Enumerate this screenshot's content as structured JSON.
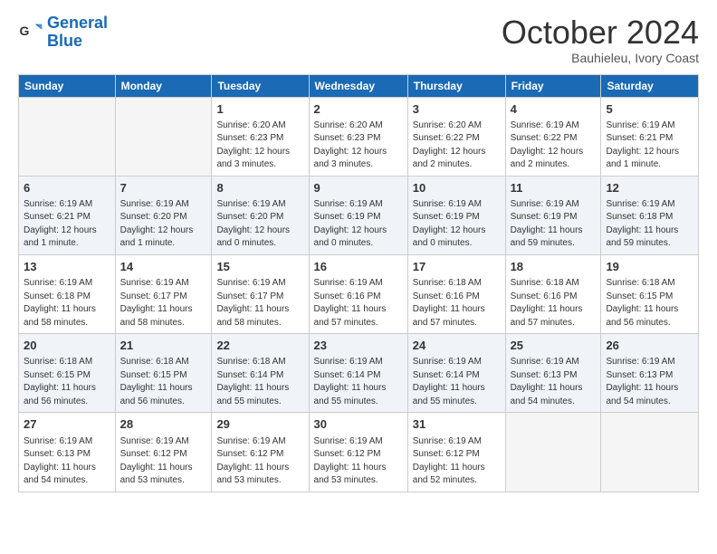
{
  "logo": {
    "line1": "General",
    "line2": "Blue"
  },
  "title": "October 2024",
  "subtitle": "Bauhieleu, Ivory Coast",
  "days_of_week": [
    "Sunday",
    "Monday",
    "Tuesday",
    "Wednesday",
    "Thursday",
    "Friday",
    "Saturday"
  ],
  "weeks": [
    [
      {
        "day": "",
        "info": ""
      },
      {
        "day": "",
        "info": ""
      },
      {
        "day": "1",
        "info": "Sunrise: 6:20 AM\nSunset: 6:23 PM\nDaylight: 12 hours and 3 minutes."
      },
      {
        "day": "2",
        "info": "Sunrise: 6:20 AM\nSunset: 6:23 PM\nDaylight: 12 hours and 3 minutes."
      },
      {
        "day": "3",
        "info": "Sunrise: 6:20 AM\nSunset: 6:22 PM\nDaylight: 12 hours and 2 minutes."
      },
      {
        "day": "4",
        "info": "Sunrise: 6:19 AM\nSunset: 6:22 PM\nDaylight: 12 hours and 2 minutes."
      },
      {
        "day": "5",
        "info": "Sunrise: 6:19 AM\nSunset: 6:21 PM\nDaylight: 12 hours and 1 minute."
      }
    ],
    [
      {
        "day": "6",
        "info": "Sunrise: 6:19 AM\nSunset: 6:21 PM\nDaylight: 12 hours and 1 minute."
      },
      {
        "day": "7",
        "info": "Sunrise: 6:19 AM\nSunset: 6:20 PM\nDaylight: 12 hours and 1 minute."
      },
      {
        "day": "8",
        "info": "Sunrise: 6:19 AM\nSunset: 6:20 PM\nDaylight: 12 hours and 0 minutes."
      },
      {
        "day": "9",
        "info": "Sunrise: 6:19 AM\nSunset: 6:19 PM\nDaylight: 12 hours and 0 minutes."
      },
      {
        "day": "10",
        "info": "Sunrise: 6:19 AM\nSunset: 6:19 PM\nDaylight: 12 hours and 0 minutes."
      },
      {
        "day": "11",
        "info": "Sunrise: 6:19 AM\nSunset: 6:19 PM\nDaylight: 11 hours and 59 minutes."
      },
      {
        "day": "12",
        "info": "Sunrise: 6:19 AM\nSunset: 6:18 PM\nDaylight: 11 hours and 59 minutes."
      }
    ],
    [
      {
        "day": "13",
        "info": "Sunrise: 6:19 AM\nSunset: 6:18 PM\nDaylight: 11 hours and 58 minutes."
      },
      {
        "day": "14",
        "info": "Sunrise: 6:19 AM\nSunset: 6:17 PM\nDaylight: 11 hours and 58 minutes."
      },
      {
        "day": "15",
        "info": "Sunrise: 6:19 AM\nSunset: 6:17 PM\nDaylight: 11 hours and 58 minutes."
      },
      {
        "day": "16",
        "info": "Sunrise: 6:19 AM\nSunset: 6:16 PM\nDaylight: 11 hours and 57 minutes."
      },
      {
        "day": "17",
        "info": "Sunrise: 6:18 AM\nSunset: 6:16 PM\nDaylight: 11 hours and 57 minutes."
      },
      {
        "day": "18",
        "info": "Sunrise: 6:18 AM\nSunset: 6:16 PM\nDaylight: 11 hours and 57 minutes."
      },
      {
        "day": "19",
        "info": "Sunrise: 6:18 AM\nSunset: 6:15 PM\nDaylight: 11 hours and 56 minutes."
      }
    ],
    [
      {
        "day": "20",
        "info": "Sunrise: 6:18 AM\nSunset: 6:15 PM\nDaylight: 11 hours and 56 minutes."
      },
      {
        "day": "21",
        "info": "Sunrise: 6:18 AM\nSunset: 6:15 PM\nDaylight: 11 hours and 56 minutes."
      },
      {
        "day": "22",
        "info": "Sunrise: 6:18 AM\nSunset: 6:14 PM\nDaylight: 11 hours and 55 minutes."
      },
      {
        "day": "23",
        "info": "Sunrise: 6:19 AM\nSunset: 6:14 PM\nDaylight: 11 hours and 55 minutes."
      },
      {
        "day": "24",
        "info": "Sunrise: 6:19 AM\nSunset: 6:14 PM\nDaylight: 11 hours and 55 minutes."
      },
      {
        "day": "25",
        "info": "Sunrise: 6:19 AM\nSunset: 6:13 PM\nDaylight: 11 hours and 54 minutes."
      },
      {
        "day": "26",
        "info": "Sunrise: 6:19 AM\nSunset: 6:13 PM\nDaylight: 11 hours and 54 minutes."
      }
    ],
    [
      {
        "day": "27",
        "info": "Sunrise: 6:19 AM\nSunset: 6:13 PM\nDaylight: 11 hours and 54 minutes."
      },
      {
        "day": "28",
        "info": "Sunrise: 6:19 AM\nSunset: 6:12 PM\nDaylight: 11 hours and 53 minutes."
      },
      {
        "day": "29",
        "info": "Sunrise: 6:19 AM\nSunset: 6:12 PM\nDaylight: 11 hours and 53 minutes."
      },
      {
        "day": "30",
        "info": "Sunrise: 6:19 AM\nSunset: 6:12 PM\nDaylight: 11 hours and 53 minutes."
      },
      {
        "day": "31",
        "info": "Sunrise: 6:19 AM\nSunset: 6:12 PM\nDaylight: 11 hours and 52 minutes."
      },
      {
        "day": "",
        "info": ""
      },
      {
        "day": "",
        "info": ""
      }
    ]
  ]
}
